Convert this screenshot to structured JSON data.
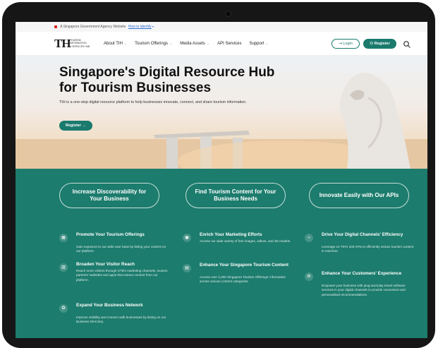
{
  "gov_banner": {
    "text": "A Singapore Government Agency Website",
    "link": "How to identify"
  },
  "nav": {
    "logo_mark": "TH",
    "logo_text": [
      "TOURISM",
      "INFORMATION",
      "& SERVICES HUB"
    ],
    "links": [
      {
        "label": "About TIH",
        "chevron": true
      },
      {
        "label": "Tourism Offerings",
        "chevron": true
      },
      {
        "label": "Media Assets",
        "chevron": true
      },
      {
        "label": "API Services",
        "chevron": false
      },
      {
        "label": "Support",
        "chevron": true
      }
    ],
    "login_label": "Login",
    "register_label": "Register",
    "search_icon": "search-icon"
  },
  "hero": {
    "title_line1": "Singapore's Digital Resource Hub",
    "title_line2": "for Tourism Businesses",
    "subtitle": "TIH is a one-stop digital resource platform to help businesses innovate, connect, and share tourism information.",
    "register_label": "Register"
  },
  "features": {
    "columns": [
      {
        "heading": "Increase Discoverability for Your Business",
        "items": [
          {
            "icon": "grid-icon",
            "title": "Promote Your Tourism Offerings",
            "desc": "Gain exposure to our wide user base by listing your content on our platform."
          },
          {
            "icon": "chart-icon",
            "title": "Broaden Your Visitor Reach",
            "desc": "Reach more visitors through STB's marketing channels, tourism partners' websites and apps that extract content from our platform."
          },
          {
            "icon": "network-icon",
            "title": "Expand Your Business Network",
            "desc": "Improve visibility and connect with businesses by listing on our Business Directory."
          }
        ]
      },
      {
        "heading": "Find Tourism Content for Your Business Needs",
        "items": [
          {
            "icon": "image-icon",
            "title": "Enrich Your Marketing Efforts",
            "desc": "Access our wide variety of free images, videos, and 3D models."
          },
          {
            "icon": "book-icon",
            "title": "Enhance Your Singapore Tourism Content",
            "desc": "Access over 3,200 Singapore Tourism Offerings' information across various content categories."
          }
        ]
      },
      {
        "heading": "Innovate Easily with Our APIs",
        "items": [
          {
            "icon": "code-icon",
            "title": "Drive Your Digital Channels' Efficiency",
            "desc": "Leverage on TIH's 100 APIs to efficiently extract tourism content in real-time."
          },
          {
            "icon": "gear-icon",
            "title": "Enhance Your Customers' Experience",
            "desc": "Empower your business with plug-and-play travel software services in your digital channels to provide convenient and personalised recommendations."
          }
        ]
      }
    ]
  }
}
